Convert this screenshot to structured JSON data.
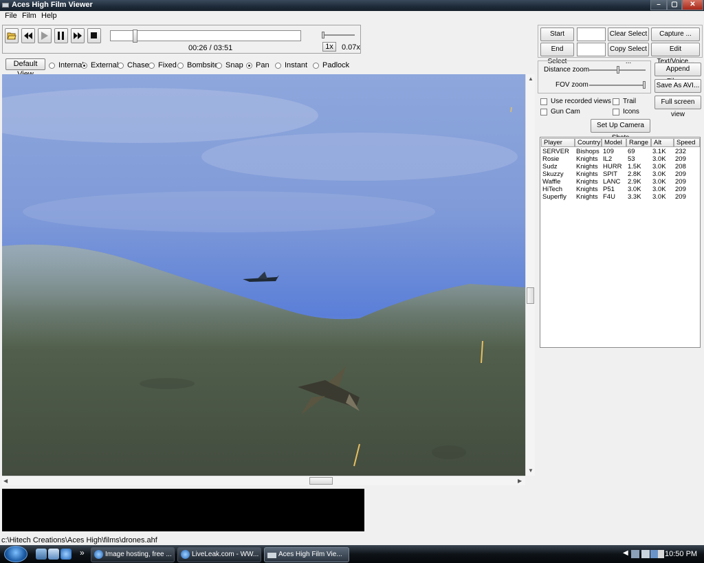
{
  "window": {
    "title": "Aces High Film Viewer",
    "min": "–",
    "max": "▢",
    "close": "✕"
  },
  "menu": [
    "File",
    "Film",
    "Help"
  ],
  "transport": {
    "timecode": "00:26 / 03:51",
    "progress": 0.12,
    "speed_button": "1x",
    "speed_value": "0.07x"
  },
  "views": {
    "default_view": "Default View",
    "modes": [
      {
        "label": "Internal",
        "selected": false
      },
      {
        "label": "External",
        "selected": true
      },
      {
        "label": "Chase",
        "selected": false
      },
      {
        "label": "Fixed",
        "selected": false
      },
      {
        "label": "Bombsite",
        "selected": false
      },
      {
        "label": "Snap",
        "selected": false
      },
      {
        "label": "Pan",
        "selected": true
      },
      {
        "label": "Instant",
        "selected": false
      },
      {
        "label": "Padlock",
        "selected": false
      }
    ]
  },
  "selection": {
    "start_select": "Start Select",
    "end_select": "End Select",
    "clear_select": "Clear Select",
    "copy_select": "Copy Select ...",
    "capture": "Capture ...",
    "edit_text": "Edit Text/Voice..."
  },
  "zoom": {
    "distance": "Distance zoom",
    "fov": "FOV zoom"
  },
  "actions": {
    "append": "Append Films...",
    "save_avi": "Save As AVI...",
    "fullscreen": "Full screen view",
    "camera_shots": "Set Up Camera Shots"
  },
  "options": {
    "use_recorded": "Use recorded views",
    "gun_cam": "Gun Cam",
    "trail": "Trail",
    "icons": "Icons"
  },
  "players": {
    "columns": [
      "Player",
      "Country",
      "Model",
      "Range",
      "Alt",
      "Speed"
    ],
    "rows": [
      [
        "SERVER",
        "Bishops",
        "109",
        "69",
        "3.1K",
        "232"
      ],
      [
        "Rosie",
        "Knights",
        "IL2",
        "53",
        "3.0K",
        "209"
      ],
      [
        "Sudz",
        "Knights",
        "HURR",
        "1.5K",
        "3.0K",
        "208"
      ],
      [
        "Skuzzy",
        "Knights",
        "SPIT",
        "2.8K",
        "3.0K",
        "209"
      ],
      [
        "Waffle",
        "Knights",
        "LANC",
        "2.9K",
        "3.0K",
        "209"
      ],
      [
        "HiTech",
        "Knights",
        "P51",
        "3.0K",
        "3.0K",
        "209"
      ],
      [
        "Superfly",
        "Knights",
        "F4U",
        "3.3K",
        "3.0K",
        "209"
      ]
    ]
  },
  "status": {
    "path": "c:\\Hitech Creations\\Aces High\\films\\drones.ahf"
  },
  "taskbar": {
    "tasks": [
      "Image hosting, free ...",
      "LiveLeak.com - WW...",
      "Aces High Film Vie..."
    ],
    "clock": "10:50 PM",
    "chevron": "»"
  },
  "icons": {
    "open": "folder-open-icon",
    "rewind": "rewind-icon",
    "play": "play-icon",
    "pause": "pause-icon",
    "ffwd": "fast-forward-icon",
    "stop": "stop-icon"
  },
  "colors": {
    "sky_top": "#8fa9dd",
    "sky_bottom": "#5a7ed8",
    "ground": "#4d5a4a",
    "taskbar": "#0e1318"
  }
}
